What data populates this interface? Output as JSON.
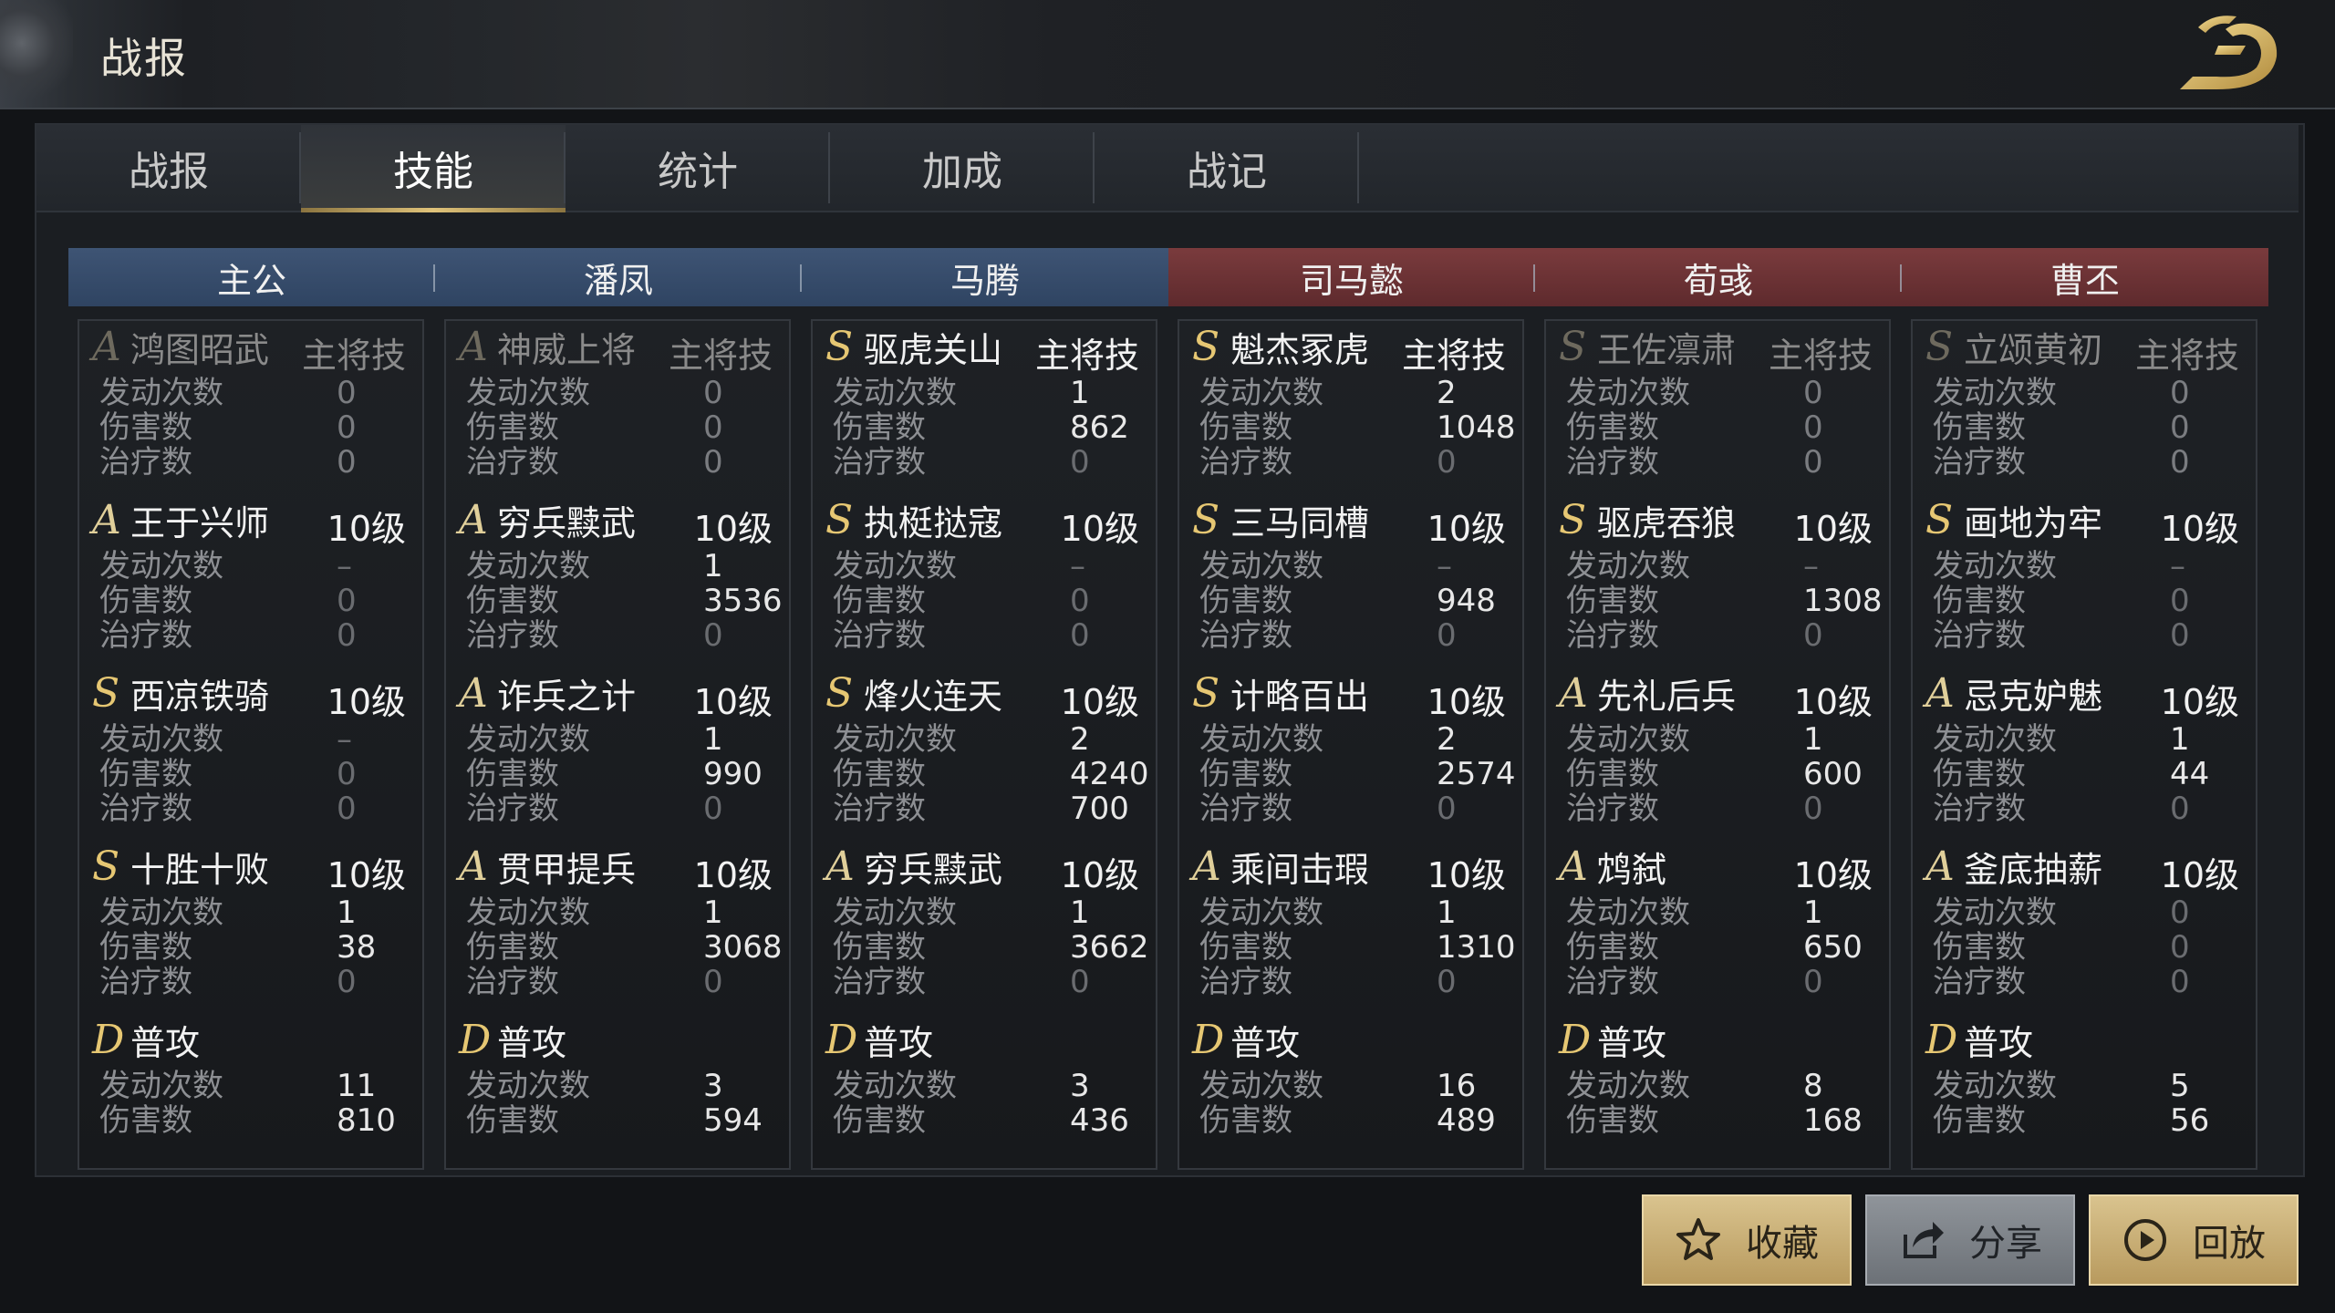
{
  "header": {
    "title": "战报"
  },
  "tabs": [
    {
      "label": "战报",
      "active": false
    },
    {
      "label": "技能",
      "active": true
    },
    {
      "label": "统计",
      "active": false
    },
    {
      "label": "加成",
      "active": false
    },
    {
      "label": "战记",
      "active": false
    }
  ],
  "stat_labels": {
    "activations": "发动次数",
    "damage": "伤害数",
    "healing": "治疗数"
  },
  "generals": [
    {
      "name": "主公",
      "side": "blue",
      "skills": [
        {
          "grade": "A",
          "name": "鸿图昭武",
          "level": "主将技",
          "dim": true,
          "stats": [
            "0",
            "0",
            "0"
          ]
        },
        {
          "grade": "A",
          "name": "王于兴师",
          "level": "10级",
          "stats": [
            "–",
            "0",
            "0"
          ]
        },
        {
          "grade": "S",
          "name": "西凉铁骑",
          "level": "10级",
          "stats": [
            "–",
            "0",
            "0"
          ]
        },
        {
          "grade": "S",
          "name": "十胜十败",
          "level": "10级",
          "stats": [
            "1",
            "38",
            "0"
          ]
        },
        {
          "grade": "D",
          "name": "普攻",
          "level": "",
          "stats": [
            "11",
            "810"
          ]
        }
      ]
    },
    {
      "name": "潘凤",
      "side": "blue",
      "skills": [
        {
          "grade": "A",
          "name": "神威上将",
          "level": "主将技",
          "dim": true,
          "stats": [
            "0",
            "0",
            "0"
          ]
        },
        {
          "grade": "A",
          "name": "穷兵黩武",
          "level": "10级",
          "stats": [
            "1",
            "3536",
            "0"
          ]
        },
        {
          "grade": "A",
          "name": "诈兵之计",
          "level": "10级",
          "stats": [
            "1",
            "990",
            "0"
          ]
        },
        {
          "grade": "A",
          "name": "贯甲提兵",
          "level": "10级",
          "stats": [
            "1",
            "3068",
            "0"
          ]
        },
        {
          "grade": "D",
          "name": "普攻",
          "level": "",
          "stats": [
            "3",
            "594"
          ]
        }
      ]
    },
    {
      "name": "马腾",
      "side": "blue",
      "skills": [
        {
          "grade": "S",
          "name": "驱虎关山",
          "level": "主将技",
          "dim": false,
          "stats": [
            "1",
            "862",
            "0"
          ]
        },
        {
          "grade": "S",
          "name": "执梃挞寇",
          "level": "10级",
          "stats": [
            "–",
            "0",
            "0"
          ]
        },
        {
          "grade": "S",
          "name": "烽火连天",
          "level": "10级",
          "stats": [
            "2",
            "4240",
            "700"
          ]
        },
        {
          "grade": "A",
          "name": "穷兵黩武",
          "level": "10级",
          "stats": [
            "1",
            "3662",
            "0"
          ]
        },
        {
          "grade": "D",
          "name": "普攻",
          "level": "",
          "stats": [
            "3",
            "436"
          ]
        }
      ]
    },
    {
      "name": "司马懿",
      "side": "red",
      "skills": [
        {
          "grade": "S",
          "name": "魁杰冢虎",
          "level": "主将技",
          "dim": false,
          "stats": [
            "2",
            "1048",
            "0"
          ]
        },
        {
          "grade": "S",
          "name": "三马同槽",
          "level": "10级",
          "stats": [
            "–",
            "948",
            "0"
          ]
        },
        {
          "grade": "S",
          "name": "计略百出",
          "level": "10级",
          "stats": [
            "2",
            "2574",
            "0"
          ]
        },
        {
          "grade": "A",
          "name": "乘间击瑕",
          "level": "10级",
          "stats": [
            "1",
            "1310",
            "0"
          ]
        },
        {
          "grade": "D",
          "name": "普攻",
          "level": "",
          "stats": [
            "16",
            "489"
          ]
        }
      ]
    },
    {
      "name": "荀彧",
      "side": "red",
      "skills": [
        {
          "grade": "S",
          "name": "王佐凛肃",
          "level": "主将技",
          "dim": true,
          "stats": [
            "0",
            "0",
            "0"
          ]
        },
        {
          "grade": "S",
          "name": "驱虎吞狼",
          "level": "10级",
          "stats": [
            "–",
            "1308",
            "0"
          ]
        },
        {
          "grade": "A",
          "name": "先礼后兵",
          "level": "10级",
          "stats": [
            "1",
            "600",
            "0"
          ]
        },
        {
          "grade": "A",
          "name": "鸩弑",
          "level": "10级",
          "stats": [
            "1",
            "650",
            "0"
          ]
        },
        {
          "grade": "D",
          "name": "普攻",
          "level": "",
          "stats": [
            "8",
            "168"
          ]
        }
      ]
    },
    {
      "name": "曹丕",
      "side": "red",
      "skills": [
        {
          "grade": "S",
          "name": "立颂黄初",
          "level": "主将技",
          "dim": true,
          "stats": [
            "0",
            "0",
            "0"
          ]
        },
        {
          "grade": "S",
          "name": "画地为牢",
          "level": "10级",
          "stats": [
            "–",
            "0",
            "0"
          ]
        },
        {
          "grade": "A",
          "name": "忌克妒魅",
          "level": "10级",
          "stats": [
            "1",
            "44",
            "0"
          ]
        },
        {
          "grade": "A",
          "name": "釜底抽薪",
          "level": "10级",
          "stats": [
            "0",
            "0",
            "0"
          ]
        },
        {
          "grade": "D",
          "name": "普攻",
          "level": "",
          "stats": [
            "5",
            "56"
          ]
        }
      ]
    }
  ],
  "actions": [
    {
      "label": "收藏",
      "icon": "star-icon"
    },
    {
      "label": "分享",
      "icon": "share-icon"
    },
    {
      "label": "回放",
      "icon": "play-icon"
    }
  ],
  "colors": {
    "accent_gold": "#e6c773",
    "ally_header": "#3e5474",
    "enemy_header": "#7a3b3d"
  }
}
